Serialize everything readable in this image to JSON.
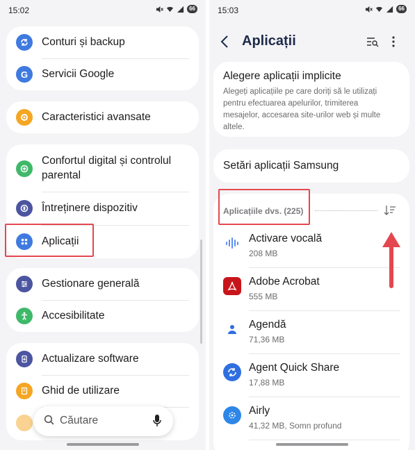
{
  "left_screen": {
    "status": {
      "time": "15:02",
      "battery": "66"
    },
    "groups": [
      {
        "items": [
          {
            "label": "Conturi și backup",
            "icon": "sync-icon",
            "color": "#3f7ae0"
          },
          {
            "label": "Servicii Google",
            "icon": "google-icon",
            "color": "#3f7ae0"
          }
        ]
      },
      {
        "items": [
          {
            "label": "Caracteristici avansate",
            "icon": "gear-plus-icon",
            "color": "#f5a623"
          }
        ]
      },
      {
        "items": [
          {
            "label_line1": "Confortul digital și controlul",
            "label_line2": "parental",
            "icon": "digital-wellbeing-icon",
            "color": "#3fb86a"
          },
          {
            "label": "Întreținere dispozitiv",
            "icon": "device-care-icon",
            "color": "#4b55a0"
          },
          {
            "label": "Aplicații",
            "icon": "apps-grid-icon",
            "color": "#3f7ae0"
          }
        ]
      },
      {
        "items": [
          {
            "label": "Gestionare generală",
            "icon": "sliders-icon",
            "color": "#4b55a0"
          },
          {
            "label": "Accesibilitate",
            "icon": "accessibility-icon",
            "color": "#3fb86a"
          }
        ]
      },
      {
        "items": [
          {
            "label": "Actualizare software",
            "icon": "software-update-icon",
            "color": "#4b55a0"
          },
          {
            "label": "Ghid de utilizare",
            "icon": "user-guide-icon",
            "color": "#f5a623"
          }
        ]
      }
    ],
    "search": {
      "placeholder": "Căutare"
    }
  },
  "right_screen": {
    "status": {
      "time": "15:03",
      "battery": "66"
    },
    "title": "Aplicații",
    "default_apps": {
      "title": "Alegere aplicații implicite",
      "description_lines": [
        "Alegeți aplicațiile pe care doriți să le utilizați",
        "pentru efectuarea apelurilor, trimiterea",
        "mesajelor, accesarea site-urilor web și multe",
        "altele."
      ]
    },
    "samsung_settings": "Setări aplicații Samsung",
    "apps_header": "Aplicațiile dvs. (225)",
    "apps": [
      {
        "name": "Activare vocală",
        "size": "208 MB",
        "icon": "voice-wake-icon",
        "color": "#5b8df0"
      },
      {
        "name": "Adobe Acrobat",
        "size": "555 MB",
        "icon": "acrobat-icon",
        "color": "#c8151b"
      },
      {
        "name": "Agendă",
        "size": "71,36 MB",
        "icon": "contacts-icon",
        "color": "#2f6fe0"
      },
      {
        "name": "Agent Quick Share",
        "size": "17,88 MB",
        "icon": "quick-share-icon",
        "color": "#2f6fe0"
      },
      {
        "name": "Airly",
        "size": "41,32 MB, Somn profund",
        "icon": "airly-icon",
        "color": "#2e86e8"
      }
    ]
  },
  "colors": {
    "highlight": "#e3474f",
    "title": "#1e2b4a"
  }
}
